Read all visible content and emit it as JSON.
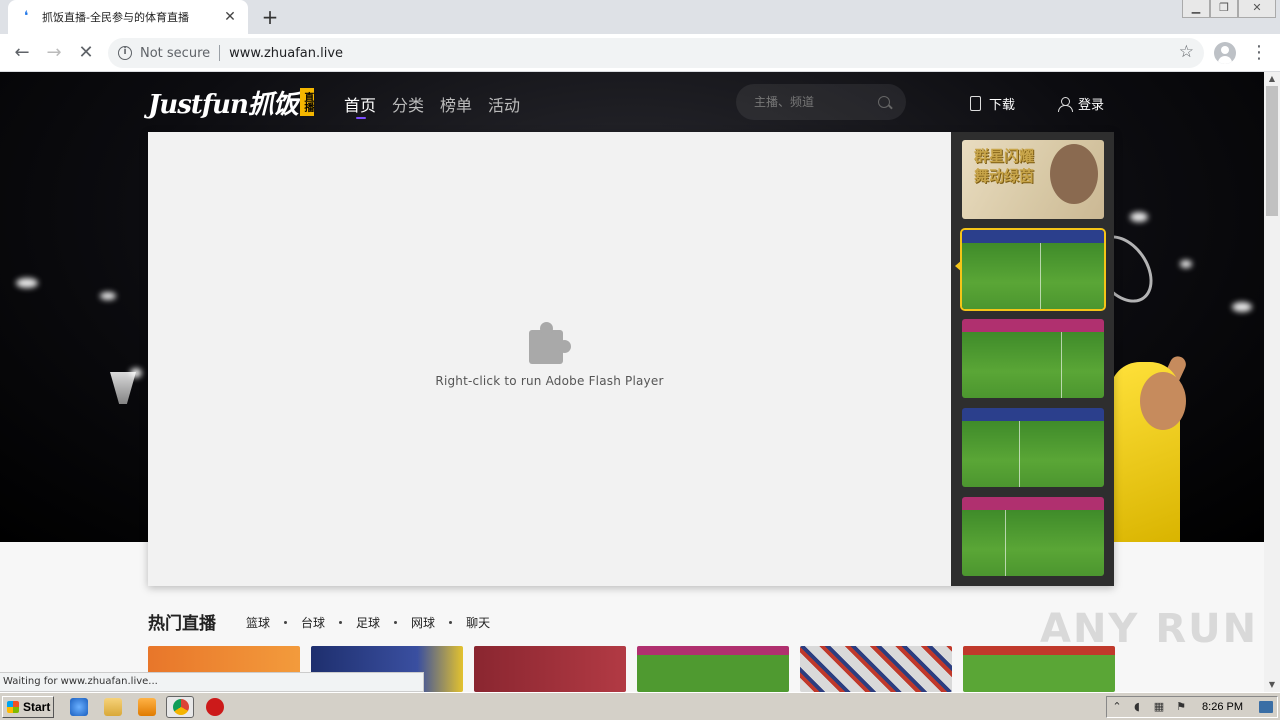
{
  "browser": {
    "tab_title": "抓饭直播-全民参与的体育直播",
    "omnibox": {
      "security_label": "Not secure",
      "url": "www.zhuafan.live"
    },
    "status_text": "Waiting for www.zhuafan.live..."
  },
  "site": {
    "logo_text": "Justfun抓饭",
    "logo_badge": "直播",
    "nav": [
      "首页",
      "分类",
      "榜单",
      "活动"
    ],
    "active_nav_index": 0,
    "search_placeholder": "主播、频道",
    "download_label": "下载",
    "login_label": "登录",
    "player": {
      "plugin_message": "Right-click to run Adobe Flash Player"
    },
    "sidebar_ad_text": "群星闪耀 舞动绿茵",
    "hot": {
      "title": "热门直播",
      "categories": [
        "篮球",
        "台球",
        "足球",
        "网球",
        "聊天"
      ]
    }
  },
  "watermark": "ANY RUN",
  "taskbar": {
    "start_label": "Start",
    "clock": "8:26 PM"
  },
  "colors": {
    "accent": "#7c4dff",
    "highlight": "#f5c518",
    "logo_badge": "#f5b700"
  }
}
